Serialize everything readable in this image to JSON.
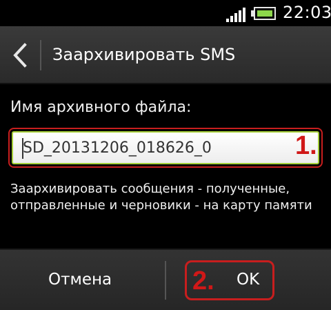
{
  "status_bar": {
    "time": "22:03",
    "signal_bars": 5,
    "battery_level": 0.75
  },
  "title_bar": {
    "title": "Заархивировать SMS",
    "back_icon": "back-chevron-icon"
  },
  "content": {
    "field_label": "Имя архивного файла:",
    "filename_value": "SD_20131206_018626_0",
    "description": "Заархивировать сообщения - полученные, отправленные и черновики - на карту памяти"
  },
  "annotations": {
    "step1": "1.",
    "step2": "2.",
    "color": "#d01818"
  },
  "buttons": {
    "cancel_label": "Отмена",
    "ok_label": "OK"
  },
  "colors": {
    "input_focus": "#a6cf3a",
    "battery_fill": "#8cd64a",
    "highlight_frame": "#c81e1e"
  }
}
